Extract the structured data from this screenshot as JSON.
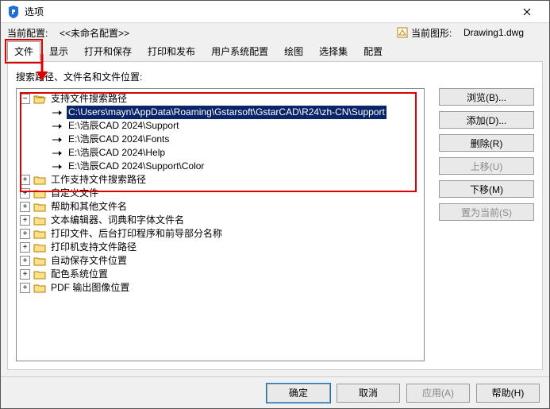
{
  "window": {
    "title": "选项"
  },
  "header": {
    "config_label": "当前配置:",
    "config_value": "<<未命名配置>>",
    "drawing_label": "当前图形:",
    "drawing_value": "Drawing1.dwg"
  },
  "tabs": [
    "文件",
    "显示",
    "打开和保存",
    "打印和发布",
    "用户系统配置",
    "绘图",
    "选择集",
    "配置"
  ],
  "active_tab": 0,
  "section_label": "搜索路径、文件名和文件位置:",
  "tree": [
    {
      "d": 0,
      "exp": "-",
      "ic": "folder-open",
      "t": "支持文件搜索路径"
    },
    {
      "d": 1,
      "exp": "",
      "ic": "path",
      "sel": true,
      "t": "C:\\Users\\mayn\\AppData\\Roaming\\Gstarsoft\\GstarCAD\\R24\\zh-CN\\Support"
    },
    {
      "d": 1,
      "exp": "",
      "ic": "path",
      "t": "E:\\浩辰CAD 2024\\Support"
    },
    {
      "d": 1,
      "exp": "",
      "ic": "path",
      "t": "E:\\浩辰CAD 2024\\Fonts"
    },
    {
      "d": 1,
      "exp": "",
      "ic": "path",
      "t": "E:\\浩辰CAD 2024\\Help"
    },
    {
      "d": 1,
      "exp": "",
      "ic": "path",
      "t": "E:\\浩辰CAD 2024\\Support\\Color"
    },
    {
      "d": 0,
      "exp": "+",
      "ic": "folder",
      "t": "工作支持文件搜索路径"
    },
    {
      "d": 0,
      "exp": "+",
      "ic": "folder",
      "t": "自定义文件"
    },
    {
      "d": 0,
      "exp": "+",
      "ic": "folder",
      "t": "帮助和其他文件名"
    },
    {
      "d": 0,
      "exp": "+",
      "ic": "folder",
      "t": "文本编辑器、词典和字体文件名"
    },
    {
      "d": 0,
      "exp": "+",
      "ic": "folder",
      "t": "打印文件、后台打印程序和前导部分名称"
    },
    {
      "d": 0,
      "exp": "+",
      "ic": "folder",
      "t": "打印机支持文件路径"
    },
    {
      "d": 0,
      "exp": "+",
      "ic": "folder",
      "t": "自动保存文件位置"
    },
    {
      "d": 0,
      "exp": "+",
      "ic": "folder",
      "t": "配色系统位置"
    },
    {
      "d": 0,
      "exp": "+",
      "ic": "folder",
      "t": "PDF 输出图像位置"
    }
  ],
  "buttons": {
    "browse": "浏览(B)...",
    "add": "添加(D)...",
    "remove": "删除(R)",
    "up": "上移(U)",
    "down": "下移(M)",
    "set_current": "置为当前(S)"
  },
  "footer": {
    "ok": "确定",
    "cancel": "取消",
    "apply": "应用(A)",
    "help": "帮助(H)"
  }
}
